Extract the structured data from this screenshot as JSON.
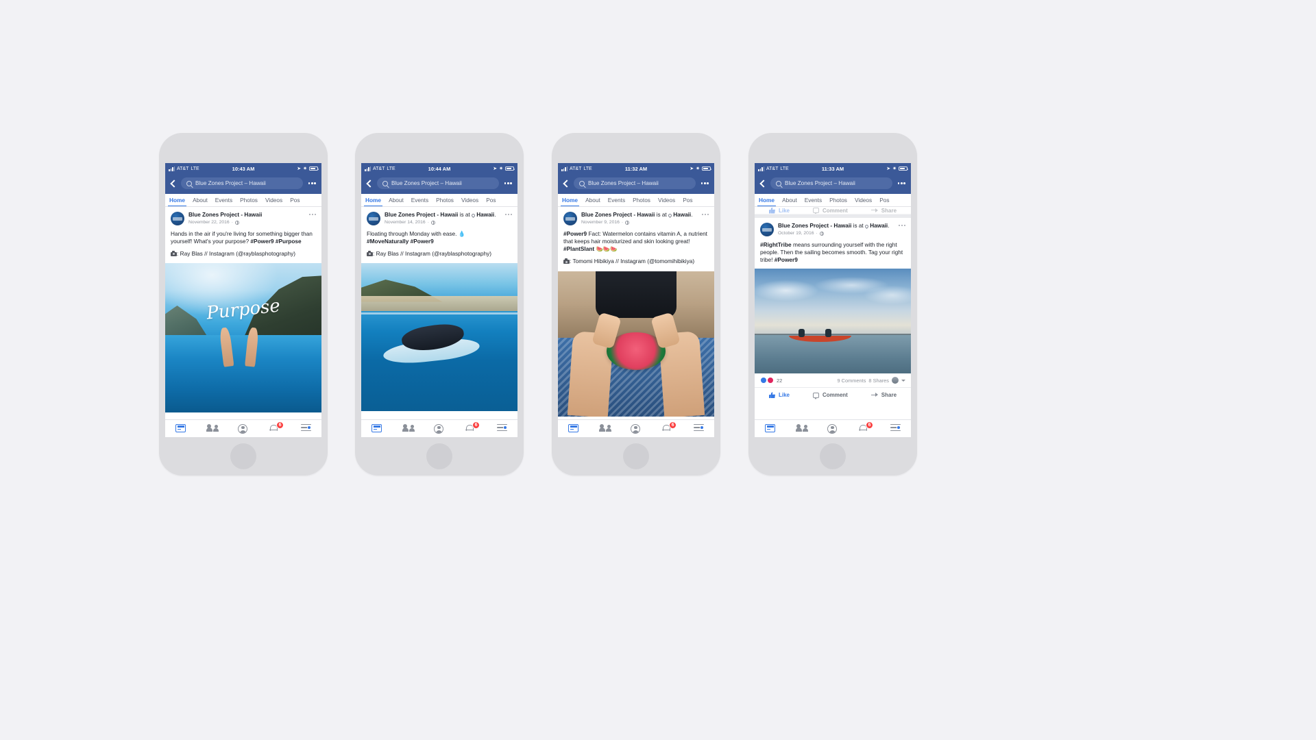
{
  "page": {
    "background_color": "#f2f2f5",
    "brand_blue": "#3b5998",
    "link_blue": "#3578e5"
  },
  "shared": {
    "carrier": "AT&T",
    "network": "LTE",
    "search_value": "Blue Zones Project – Hawaii",
    "back_icon": "back-chevron-icon",
    "search_icon": "search-icon",
    "more_icon": "more-options-icon",
    "tabs": [
      "Home",
      "About",
      "Events",
      "Photos",
      "Videos",
      "Pos"
    ],
    "active_tab": "Home",
    "page_name": "Blue Zones Project - Hawaii",
    "checkin_suffix": "is at",
    "location": "Hawaii",
    "privacy_icon": "globe-icon",
    "camera_icon": "camera-icon",
    "tabbar": {
      "news_label": "news-feed-icon",
      "friends_label": "friends-icon",
      "profile_label": "profile-icon",
      "notifications_label": "notifications-icon",
      "notifications_badge": "6",
      "menu_label": "menu-icon"
    },
    "actions": {
      "like": "Like",
      "comment": "Comment",
      "share": "Share"
    }
  },
  "phones": [
    {
      "id": "phone-1",
      "time": "10:43 AM",
      "post": {
        "author": "Blue Zones Project - Hawaii",
        "has_checkin": false,
        "date": "November 22, 2016",
        "body_lines": [
          {
            "text": "Hands in the air if you're living for something bigger than yourself! What's your purpose? ",
            "bold": false
          },
          {
            "text": "#Power9 #Purpose",
            "bold": true
          }
        ],
        "credit": ": Ray Blas // Instagram (@rayblasphotography)",
        "photo_name": "photo-purpose-ocean-hands",
        "photo_overlay_text": "Purpose"
      }
    },
    {
      "id": "phone-2",
      "time": "10:44 AM",
      "post": {
        "author": "Blue Zones Project - Hawaii",
        "has_checkin": true,
        "date": "November 14, 2016",
        "body_lines": [
          {
            "text": "Floating through Monday with ease. 💧",
            "bold": false
          },
          {
            "text": "#MoveNaturally #Power9",
            "bold": true
          }
        ],
        "credit": ": Ray Blas // Instagram (@rayblasphotography)",
        "photo_name": "photo-floating-surfboard",
        "photo_overlay_text": ""
      }
    },
    {
      "id": "phone-3",
      "time": "11:32 AM",
      "post": {
        "author": "Blue Zones Project - Hawaii",
        "has_checkin": true,
        "date": "November 9, 2016",
        "body_lines": [
          {
            "text": "#Power9",
            "bold": true
          },
          {
            "text": " Fact: Watermelon contains vitamin A, a nutrient that keeps hair moisturized and skin looking great! ",
            "bold": false
          },
          {
            "text": "#PlantSlant",
            "bold": true
          },
          {
            "text": " 🍉🍉🍉",
            "bold": false
          }
        ],
        "credit": ": Tomomi Hibikiya // Instagram (@tomomihibikiya)",
        "photo_name": "photo-watermelon-beach",
        "photo_overlay_text": ""
      }
    },
    {
      "id": "phone-4",
      "time": "11:33 AM",
      "post": {
        "author": "Blue Zones Project - Hawaii",
        "has_checkin": true,
        "date": "October 19, 2016",
        "body_lines": [
          {
            "text": "#RightTribe",
            "bold": true
          },
          {
            "text": " means surrounding yourself with the right people. Then the sailing becomes smooth. Tag your right tribe! ",
            "bold": false
          },
          {
            "text": "#Power9",
            "bold": true
          }
        ],
        "credit": "",
        "photo_name": "photo-outrigger-canoe-sunset",
        "photo_overlay_text": ""
      },
      "engagement": {
        "reaction_count": "22",
        "comments": "9 Comments",
        "shares": "8 Shares"
      }
    }
  ]
}
